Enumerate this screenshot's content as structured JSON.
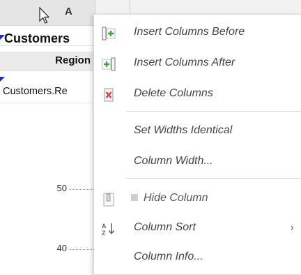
{
  "sheet": {
    "column_header": "A",
    "title_cell": "Customers",
    "region_cell": "Region",
    "data_cell": "Customers.Re",
    "axis_ticks": [
      "50",
      "40"
    ]
  },
  "menu": {
    "items": [
      {
        "label": "Insert Columns Before",
        "icon": "insert-columns-before-icon"
      },
      {
        "label": "Insert Columns After",
        "icon": "insert-columns-after-icon"
      },
      {
        "label": "Delete Columns",
        "icon": "delete-columns-icon"
      },
      {
        "label": "Set Widths Identical",
        "icon": ""
      },
      {
        "label": "Column Width...",
        "icon": ""
      },
      {
        "label": "Hide Column",
        "icon": "hide-column-icon"
      },
      {
        "label": "Column Sort",
        "icon": "sort-az-icon",
        "submenu_arrow": "›"
      },
      {
        "label": "Column Info...",
        "icon": ""
      }
    ]
  },
  "colors": {
    "accent_green": "#3aa53a",
    "delete_red": "#e03a3a",
    "marker_blue": "#1f2db8"
  }
}
